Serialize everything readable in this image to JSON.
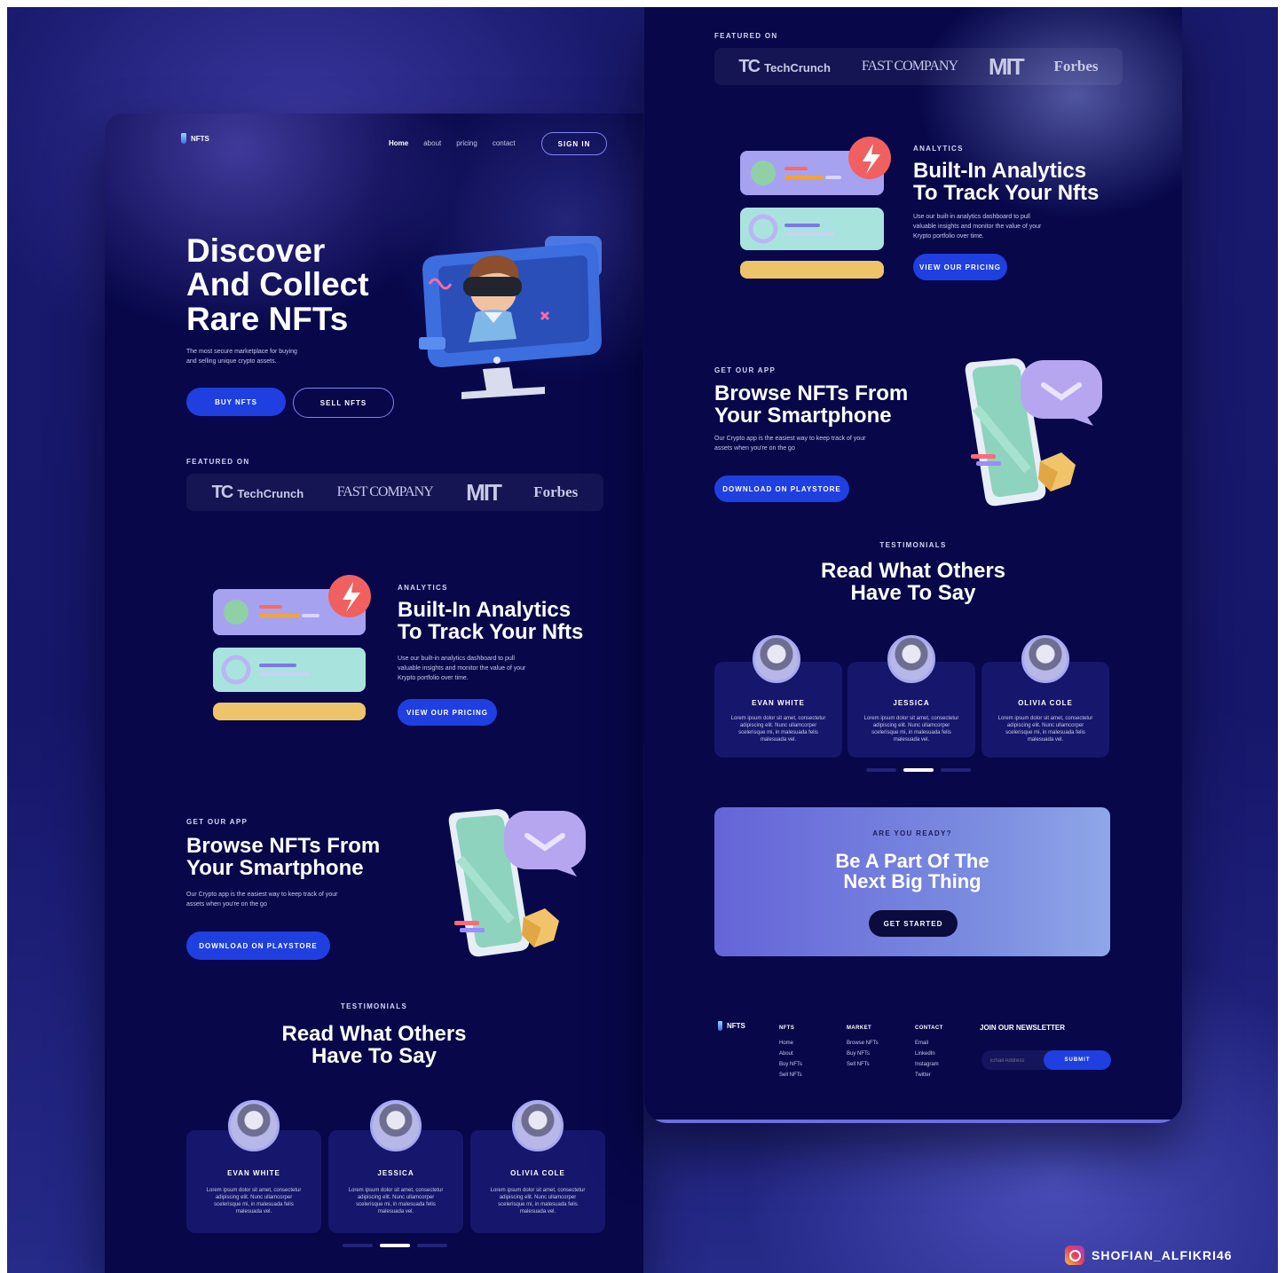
{
  "brand": {
    "name": "NFTS"
  },
  "nav": {
    "home": "Home",
    "about": "about",
    "pricing": "pricing",
    "contact": "contact",
    "sign_in": "SIGN IN"
  },
  "hero": {
    "title": "Discover\nAnd Collect\nRare NFTs",
    "subtitle": "The most secure marketplace for buying\nand selling unique crypto assets.",
    "buy": "BUY NFTS",
    "sell": "SELL NFTS"
  },
  "featured": {
    "label": "FEATURED ON",
    "tc_mark": "TC",
    "tc": "TechCrunch",
    "fc": "FAST COMPANY",
    "mit": "MIT",
    "forbes": "Forbes"
  },
  "analytics": {
    "eyebrow": "ANALYTICS",
    "title": "Built-In Analytics\nTo Track Your Nfts",
    "body": "Use our built-in analytics dashboard to pull\nvaluable insights and monitor the value of your\nKrypto portfolio over time.",
    "button": "VIEW OUR PRICING"
  },
  "app": {
    "eyebrow": "GET OUR APP",
    "title": "Browse NFTs From\nYour Smartphone",
    "body": "Our Crypto app is the easiest way to keep track of your\nassets when you're on the go",
    "button": "DOWNLOAD ON PLAYSTORE"
  },
  "testimonials": {
    "eyebrow": "TESTIMONIALS",
    "title": "Read What Others\nHave To Say",
    "items": [
      {
        "name": "EVAN WHITE",
        "text": "Lorem ipsum dolor sit amet, consectetur\nadipiscing elit. Nunc ullamcorper\nscelerisque mi, in malesuada felis\nmalesuada vel."
      },
      {
        "name": "JESSICA",
        "text": "Lorem ipsum dolor sit amet, consectetur\nadipiscing elit. Nunc ullamcorper\nscelerisque mi, in malesuada felis\nmalesuada vel."
      },
      {
        "name": "OLIVIA COLE",
        "text": "Lorem ipsum dolor sit amet, consectetur\nadipiscing elit. Nunc ullamcorper\nscelerisque mi, in malesuada felis\nmalesuada vel."
      }
    ]
  },
  "cta": {
    "eyebrow": "ARE YOU READY?",
    "title": "Be A Part Of The\nNext Big Thing",
    "button": "GET STARTED"
  },
  "footer": {
    "cols": [
      {
        "head": "NFTS",
        "items": [
          "Home",
          "About",
          "Buy NFTs",
          "Sell NFTs"
        ]
      },
      {
        "head": "MARKET",
        "items": [
          "Browse NFTs",
          "Buy NFTs",
          "Sell NFTs"
        ]
      },
      {
        "head": "CONTACT",
        "items": [
          "Email",
          "LinkedIn",
          "Instagram",
          "Twitter"
        ]
      }
    ],
    "newsletter": {
      "title": "JOIN OUR NEWSLETTER",
      "placeholder": "Email Address",
      "button": "SUBMIT"
    }
  },
  "credit": "SHOFIAN_ALFIKRI46",
  "colors": {
    "background": "#1a1a6e",
    "panel": "#07074a",
    "accent": "#1f3fe0",
    "cta": "#6564d8"
  }
}
